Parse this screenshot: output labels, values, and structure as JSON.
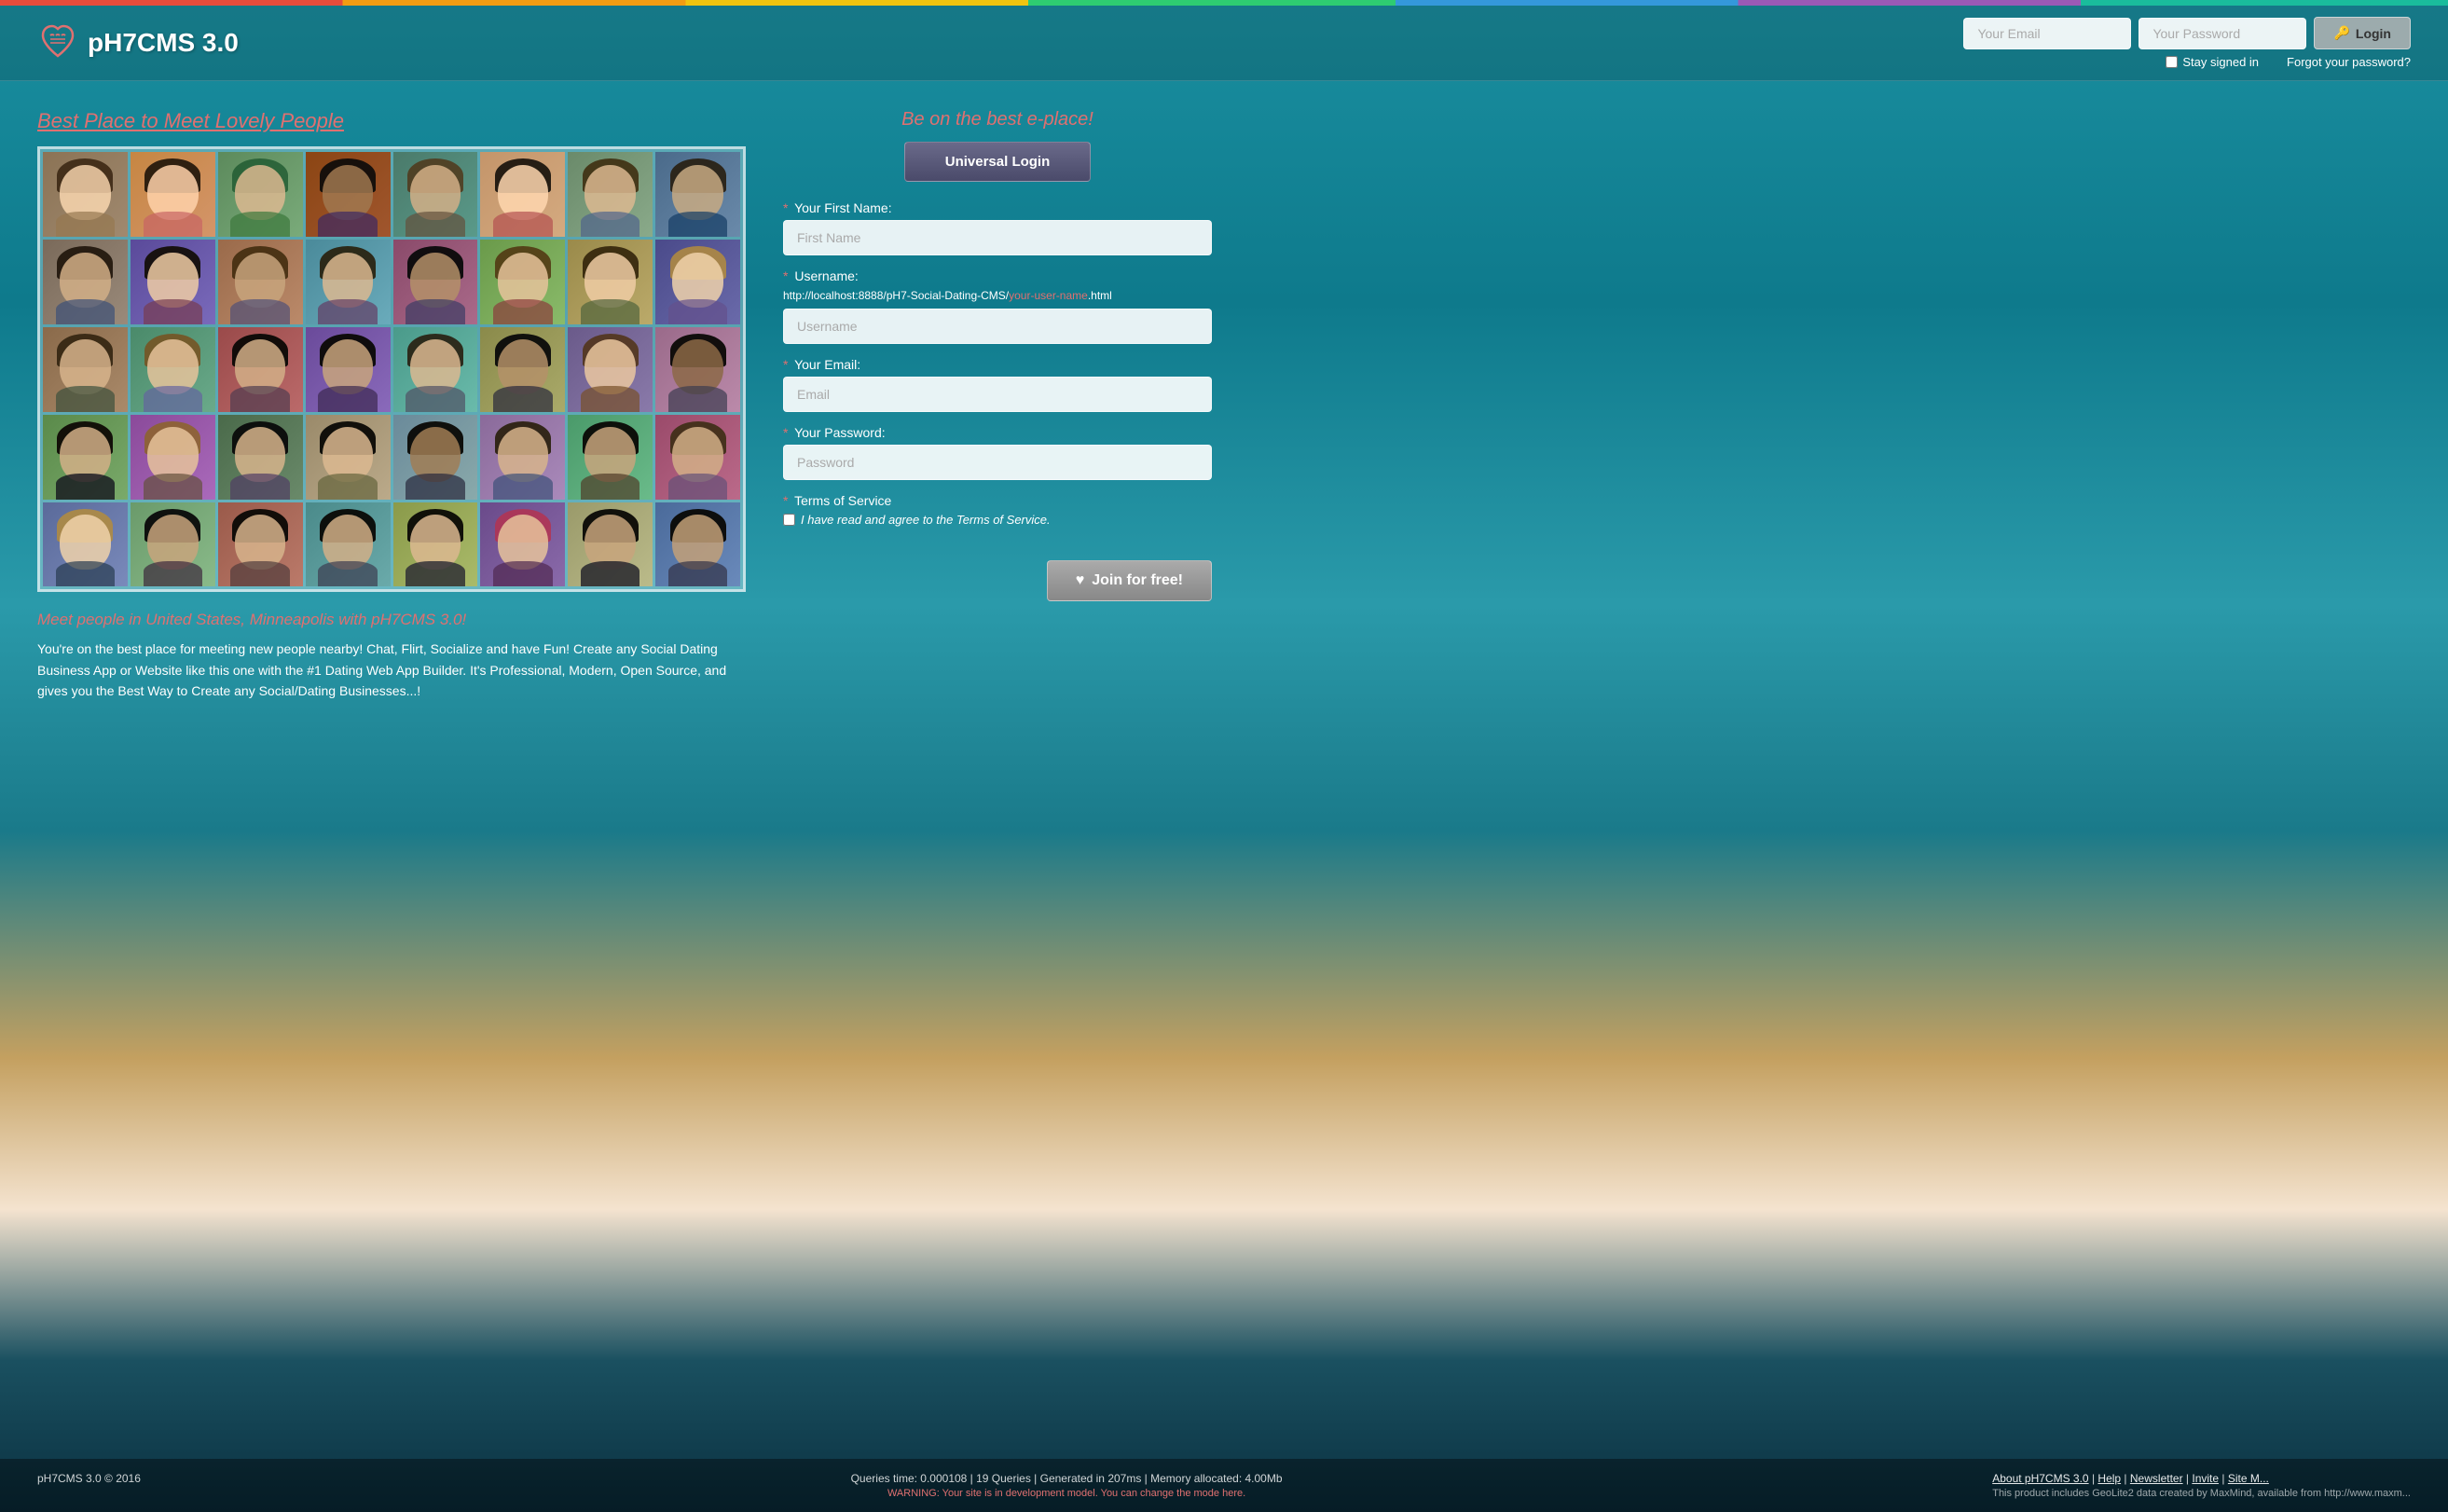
{
  "topBar": {
    "colors": [
      "#e74c3c",
      "#f39c12",
      "#f1c40f",
      "#2ecc71",
      "#3498db",
      "#9b59b6",
      "#1abc9c"
    ]
  },
  "header": {
    "logoText": "pH7CMS 3.0",
    "emailPlaceholder": "Your Email",
    "passwordPlaceholder": "Your Password",
    "loginLabel": "Login",
    "staySignedLabel": "Stay signed in",
    "forgotLabel": "Forgot your password?",
    "lockIcon": "🔑"
  },
  "leftCol": {
    "sectionTitle": "Best Place to Meet Lovely People",
    "descTitle": "Meet people in United States, Minneapolis with pH7CMS 3.0!",
    "descText": "You're on the best place for meeting new people nearby! Chat, Flirt, Socialize and have Fun! Create any Social Dating Business App or Website like this one with the #1 Dating Web App Builder. It's Professional, Modern, Open Source, and gives you the Best Way to Create any Social/Dating Businesses...!",
    "photos": [
      {
        "id": "p1",
        "label": "Person 1"
      },
      {
        "id": "p2",
        "label": "Person 2"
      },
      {
        "id": "p3",
        "label": "Person 3"
      },
      {
        "id": "p4",
        "label": "Person 4"
      },
      {
        "id": "p5",
        "label": "Person 5"
      },
      {
        "id": "p6",
        "label": "Person 6"
      },
      {
        "id": "p7",
        "label": "Person 7"
      },
      {
        "id": "p8",
        "label": "Person 8"
      },
      {
        "id": "p9",
        "label": "Person 9"
      },
      {
        "id": "p10",
        "label": "Person 10"
      },
      {
        "id": "p11",
        "label": "Person 11"
      },
      {
        "id": "p12",
        "label": "Person 12"
      },
      {
        "id": "p13",
        "label": "Person 13"
      },
      {
        "id": "p14",
        "label": "Person 14"
      },
      {
        "id": "p15",
        "label": "Person 15"
      },
      {
        "id": "p16",
        "label": "Person 16"
      },
      {
        "id": "p17",
        "label": "Person 17"
      },
      {
        "id": "p18",
        "label": "Person 18"
      },
      {
        "id": "p19",
        "label": "Person 19"
      },
      {
        "id": "p20",
        "label": "Person 20"
      },
      {
        "id": "p21",
        "label": "Person 21"
      },
      {
        "id": "p22",
        "label": "Person 22"
      },
      {
        "id": "p23",
        "label": "Person 23"
      },
      {
        "id": "p24",
        "label": "Person 24"
      },
      {
        "id": "p25",
        "label": "Person 25"
      },
      {
        "id": "p26",
        "label": "Person 26"
      },
      {
        "id": "p27",
        "label": "Person 27"
      },
      {
        "id": "p28",
        "label": "Person 28"
      },
      {
        "id": "p29",
        "label": "Person 29"
      },
      {
        "id": "p30",
        "label": "Person 30"
      },
      {
        "id": "p31",
        "label": "Person 31"
      },
      {
        "id": "p32",
        "label": "Person 32"
      },
      {
        "id": "p33",
        "label": "Person 33"
      },
      {
        "id": "p34",
        "label": "Person 34"
      },
      {
        "id": "p35",
        "label": "Person 35"
      },
      {
        "id": "p36",
        "label": "Person 36"
      },
      {
        "id": "p37",
        "label": "Person 37"
      },
      {
        "id": "p38",
        "label": "Person 38"
      },
      {
        "id": "p39",
        "label": "Person 39"
      },
      {
        "id": "p40",
        "label": "Person 40"
      }
    ]
  },
  "rightCol": {
    "headerText": "Be on the best e-place!",
    "universalLoginLabel": "Universal Login",
    "firstNameLabel": "Your First Name:",
    "firstNameRequired": "*",
    "firstNamePlaceholder": "First Name",
    "usernameLabel": "Username:",
    "usernameRequired": "*",
    "usernameHintBlack": "http://localhost:8888/pH7-Social-Dating-CMS/",
    "usernameHintRed": "your-user-name",
    "usernameHintBlack2": ".html",
    "usernamePlaceholder": "Username",
    "emailLabel": "Your Email:",
    "emailRequired": "*",
    "emailPlaceholder": "Email",
    "passwordLabel": "Your Password:",
    "passwordRequired": "*",
    "passwordPlaceholder": "Password",
    "termsLabel": "Terms of Service",
    "termsRequired": "*",
    "termsCheckboxLabel": "I have read and agree to the Terms of Service.",
    "joinLabel": "Join for free!",
    "heartIcon": "♥"
  },
  "footer": {
    "copyright": "pH7CMS 3.0 © 2016",
    "stats": "Queries time: 0.000108 | 19 Queries | Generated in 207ms | Memory allocated: 4.00Mb",
    "warning": "WARNING: Your site is in development model. You can change the mode here.",
    "links": [
      "About pH7CMS 3.0",
      "Help",
      "Newsletter",
      "Invite",
      "Site M..."
    ],
    "geoLite": "This product includes GeoLite2 data created by MaxMind, available from http://www.maxm..."
  }
}
